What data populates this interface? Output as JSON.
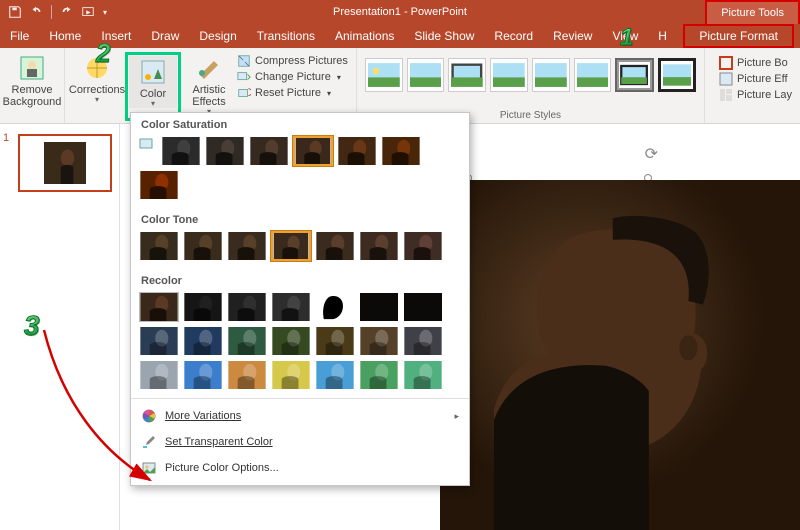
{
  "app": {
    "title": "Presentation1 - PowerPoint",
    "tools_context": "Picture Tools"
  },
  "tabs": {
    "file": "File",
    "home": "Home",
    "insert": "Insert",
    "draw": "Draw",
    "design": "Design",
    "transitions": "Transitions",
    "animations": "Animations",
    "slideshow": "Slide Show",
    "record": "Record",
    "review": "Review",
    "view": "View",
    "help": "H",
    "picture_format": "Picture Format"
  },
  "ribbon": {
    "remove_bg": "Remove\nBackground",
    "corrections": "Corrections",
    "color": "Color",
    "artistic": "Artistic\nEffects",
    "compress": "Compress Pictures",
    "change": "Change Picture",
    "reset": "Reset Picture",
    "styles_label": "Picture Styles",
    "border": "Picture Bo",
    "effects": "Picture Eff",
    "layout": "Picture Lay"
  },
  "dropdown": {
    "sat_title": "Color Saturation",
    "tone_title": "Color Tone",
    "recolor_title": "Recolor",
    "more_variations": "More Variations",
    "set_transparent": "Set Transparent Color",
    "options": "Picture Color Options...",
    "saturation_steps": [
      0,
      33,
      66,
      100,
      150,
      200,
      300
    ],
    "tone_steps": [
      4700,
      5300,
      5900,
      6500,
      7200,
      8800,
      11200
    ],
    "recolor_rows": [
      [
        "original",
        "gray25",
        "gray50",
        "gray75",
        "bw",
        "black",
        "black"
      ],
      [
        "#2a3d55",
        "#203a60",
        "#2d5a40",
        "#354a20",
        "#4a3a18",
        "#55402a",
        "#404048"
      ],
      [
        "#9aa5b0",
        "#3d7ecc",
        "#cc8a40",
        "#d6c84a",
        "#4a9ed6",
        "#4aa060",
        "#50b080"
      ]
    ]
  },
  "slide": {
    "number": "1"
  },
  "callouts": {
    "one": "1",
    "two": "2",
    "three": "3"
  }
}
